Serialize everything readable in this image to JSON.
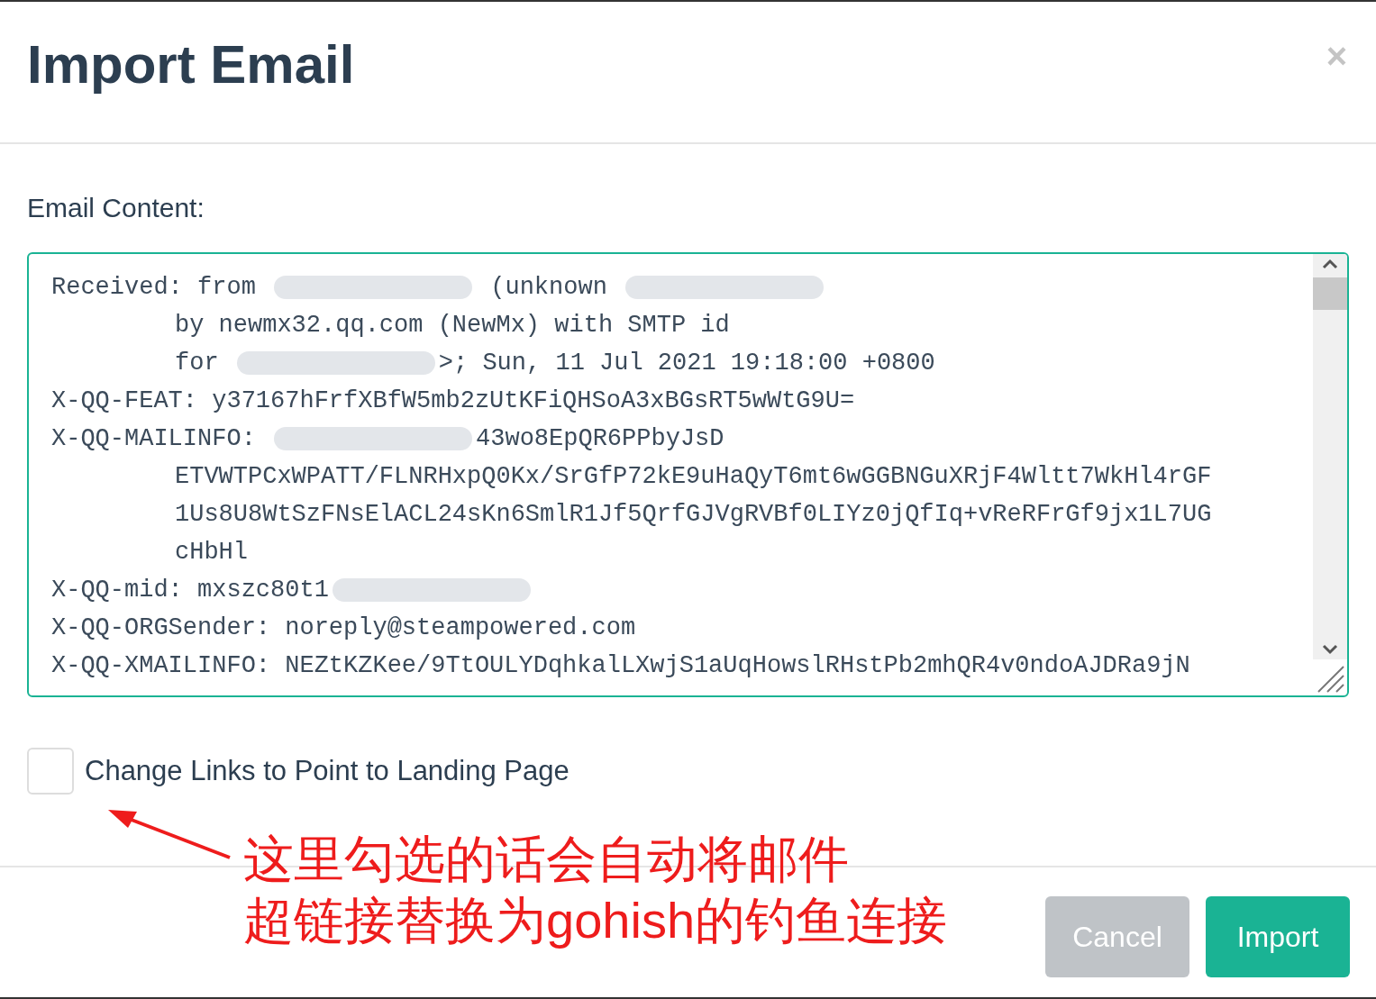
{
  "dialog": {
    "title": "Import Email",
    "close": "×"
  },
  "email_content": {
    "label": "Email Content:",
    "lines": [
      {
        "indented": false,
        "segments": [
          {
            "kind": "text",
            "text": "Received: from "
          },
          {
            "kind": "redacted"
          },
          {
            "kind": "text",
            "text": " (unknown "
          },
          {
            "kind": "redacted"
          }
        ]
      },
      {
        "indented": true,
        "segments": [
          {
            "kind": "text",
            "text": "by newmx32.qq.com (NewMx) with SMTP id"
          }
        ]
      },
      {
        "indented": true,
        "segments": [
          {
            "kind": "text",
            "text": "for "
          },
          {
            "kind": "redacted"
          },
          {
            "kind": "text",
            "text": ">; Sun, 11 Jul 2021 19:18:00 +0800"
          }
        ]
      },
      {
        "indented": false,
        "segments": [
          {
            "kind": "text",
            "text": "X-QQ-FEAT: y37167hFrfXBfW5mb2zUtKFiQHSoA3xBGsRT5wWtG9U="
          }
        ]
      },
      {
        "indented": false,
        "segments": [
          {
            "kind": "text",
            "text": "X-QQ-MAILINFO: "
          },
          {
            "kind": "redacted"
          },
          {
            "kind": "text",
            "text": "43wo8EpQR6PPbyJsD"
          }
        ]
      },
      {
        "indented": true,
        "segments": [
          {
            "kind": "text",
            "text": "ETVWTPCxWPATT/FLNRHxpQ0Kx/SrGfP72kE9uHaQyT6mt6wGGBNGuXRjF4Wltt7WkHl4rGF"
          }
        ]
      },
      {
        "indented": true,
        "segments": [
          {
            "kind": "text",
            "text": "1Us8U8WtSzFNsElACL24sKn6SmlR1Jf5QrfGJVgRVBf0LIYz0jQfIq+vReRFrGf9jx1L7UG"
          }
        ]
      },
      {
        "indented": true,
        "segments": [
          {
            "kind": "text",
            "text": "cHbHl"
          }
        ]
      },
      {
        "indented": false,
        "segments": [
          {
            "kind": "text",
            "text": "X-QQ-mid: mxszc80t1"
          },
          {
            "kind": "redacted"
          }
        ]
      },
      {
        "indented": false,
        "segments": [
          {
            "kind": "text",
            "text": "X-QQ-ORGSender: noreply@steampowered.com"
          }
        ]
      },
      {
        "indented": false,
        "segments": [
          {
            "kind": "text",
            "text": "X-QQ-XMAILINFO: NEZtKZKee/9TtOULYDqhkalLXwjS1aUqHowslRHstPb2mhQR4v0ndoAJDRa9jN"
          }
        ]
      }
    ]
  },
  "change_links": {
    "label": "Change Links to Point to Landing Page",
    "checked": false
  },
  "buttons": [
    {
      "label": "Cancel",
      "kind": "secondary"
    },
    {
      "label": "Import",
      "kind": "primary"
    }
  ],
  "annotation": {
    "lines": [
      "这里勾选的话会自动将邮件",
      "超链接替换为gohish的钓鱼连接"
    ]
  }
}
